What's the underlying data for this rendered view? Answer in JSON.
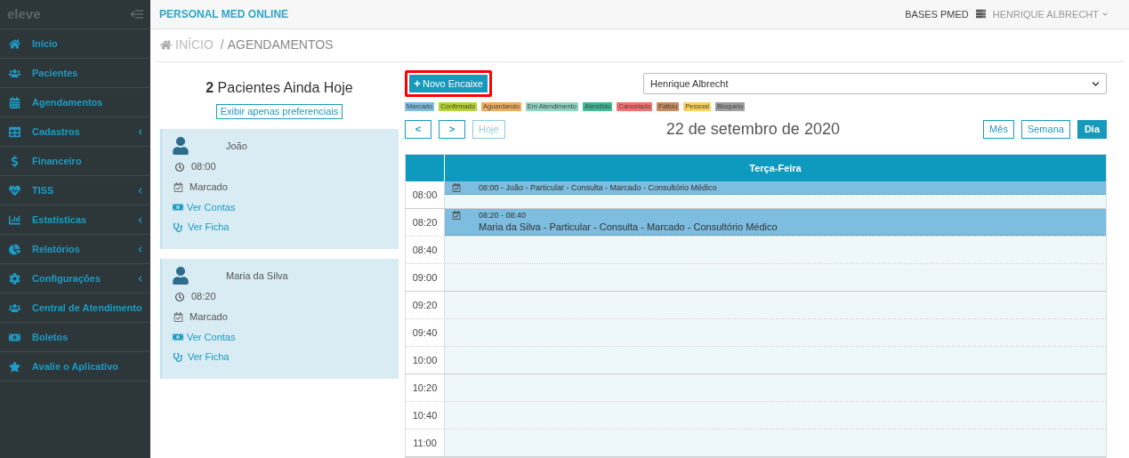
{
  "sidebar": {
    "logo": "eleve",
    "items": [
      {
        "label": "Início",
        "submenu": false
      },
      {
        "label": "Pacientes",
        "submenu": false
      },
      {
        "label": "Agendamentos",
        "submenu": false
      },
      {
        "label": "Cadastros",
        "submenu": true
      },
      {
        "label": "Financeiro",
        "submenu": false
      },
      {
        "label": "TISS",
        "submenu": true
      },
      {
        "label": "Estatísticas",
        "submenu": true
      },
      {
        "label": "Relatórios",
        "submenu": true
      },
      {
        "label": "Configurações",
        "submenu": true
      },
      {
        "label": "Central de Atendimento",
        "submenu": false
      },
      {
        "label": "Boletos",
        "submenu": false
      },
      {
        "label": "Avalie o Aplicativo",
        "submenu": false
      }
    ]
  },
  "topbar": {
    "title": "PERSONAL MED ONLINE",
    "base": "BASES PMED",
    "user": "HENRIQUE ALBRECHT"
  },
  "breadcrumb": {
    "home": "INÍCIO",
    "separator": "/",
    "current": "AGENDAMENTOS"
  },
  "patients": {
    "count": "2",
    "heading": "Pacientes Ainda Hoje",
    "filter_button": "Exibir apenas preferenciais",
    "cards": [
      {
        "name": "João",
        "time": "08:00",
        "status": "Marcado",
        "accounts_link": "Ver Contas",
        "record_link": "Ver Ficha"
      },
      {
        "name": "Maria da Silva",
        "time": "08:20",
        "status": "Marcado",
        "accounts_link": "Ver Contas",
        "record_link": "Ver Ficha"
      }
    ]
  },
  "new_button": {
    "label": "Novo Encaixe",
    "highlighted": true
  },
  "professional_select": {
    "value": "Henrique Albrecht"
  },
  "legend": [
    {
      "label": "Marcado",
      "color": "#7cbde0"
    },
    {
      "label": "Confirmado",
      "color": "#b5d334"
    },
    {
      "label": "Aguardando",
      "color": "#f0ad5e"
    },
    {
      "label": "Em Atendimento",
      "color": "#8fd3c1"
    },
    {
      "label": "Atendido",
      "color": "#3cbc94"
    },
    {
      "label": "Cancelado",
      "color": "#f57070"
    },
    {
      "label": "Faltou",
      "color": "#c98a5e"
    },
    {
      "label": "Pessoal",
      "color": "#fbd15b"
    },
    {
      "label": "Bloqueio",
      "color": "#9e9e9e"
    }
  ],
  "nav": {
    "prev": "<",
    "next": ">",
    "today": "Hoje"
  },
  "date": "22 de setembro de 2020",
  "views": [
    {
      "label": "Mês",
      "selected": false
    },
    {
      "label": "Semana",
      "selected": false
    },
    {
      "label": "Dia",
      "selected": true
    }
  ],
  "calendar": {
    "day": "Terça-Feira",
    "slots": [
      {
        "time": "08:00",
        "event": {
          "title": "08:00 - João - Particular - Consulta - Marcado - Consultório Médico"
        }
      },
      {
        "time": "08:20",
        "event": {
          "time_range": "08:20 - 08:40",
          "title": "Maria da Silva - Particular - Consulta - Marcado - Consultório Médico"
        }
      },
      {
        "time": "08:40"
      },
      {
        "time": "09:00"
      },
      {
        "time": "09:20"
      },
      {
        "time": "09:40"
      },
      {
        "time": "10:00"
      },
      {
        "time": "10:20"
      },
      {
        "time": "10:40"
      },
      {
        "time": "11:00"
      }
    ]
  }
}
